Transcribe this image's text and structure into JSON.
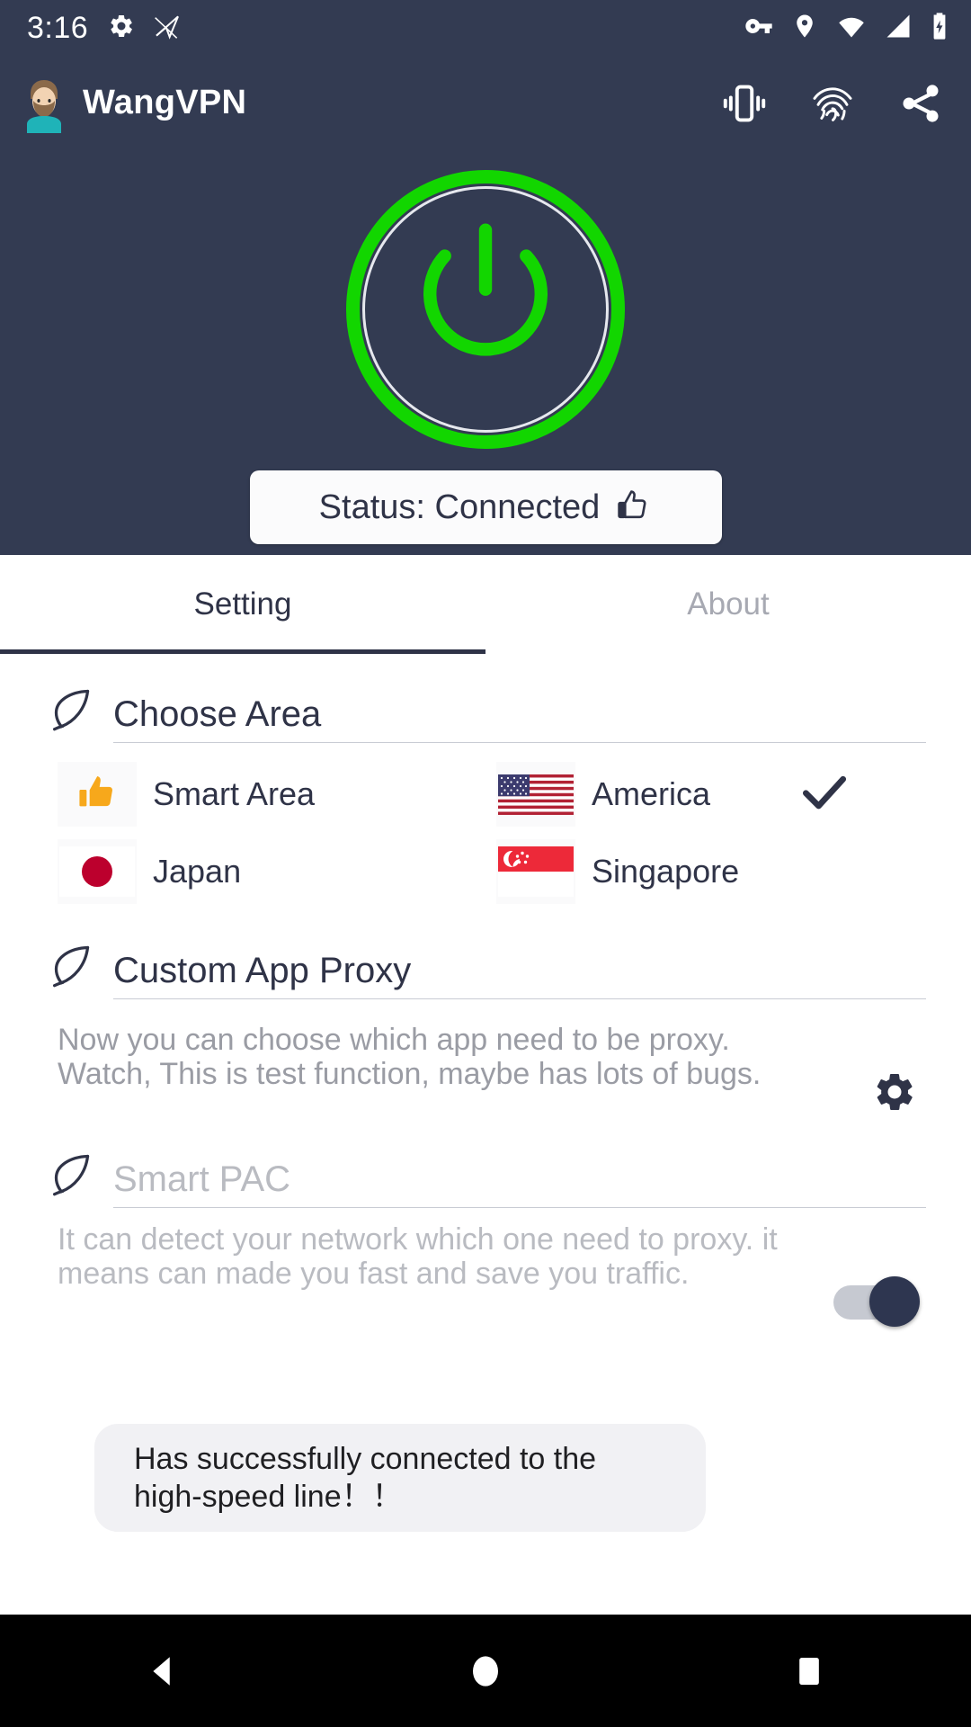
{
  "status_bar": {
    "clock": "3:16",
    "left_icons": [
      "gear-icon",
      "paper-plane-slash-icon"
    ],
    "right_icons": [
      "vpn-key-icon",
      "location-pin-icon",
      "wifi-icon",
      "cell-signal-icon",
      "battery-charging-icon"
    ]
  },
  "app_bar": {
    "title": "WangVPN",
    "avatar": "user-avatar",
    "actions": [
      "vibrate-icon",
      "fingerprint-icon",
      "share-icon"
    ]
  },
  "hero": {
    "power_button": "power-toggle-button",
    "power_state": "on",
    "status_text": "Status: Connected",
    "status_icon": "thumbs-up-icon",
    "ring_color": "#12d600",
    "background_color": "#333b52"
  },
  "tabs": [
    {
      "label": "Setting",
      "active": true
    },
    {
      "label": "About",
      "active": false
    }
  ],
  "sections": {
    "choose_area": {
      "icon": "leaf-icon",
      "title": "Choose Area",
      "options": [
        {
          "label": "Smart Area",
          "flag": "thumbs-up-orange",
          "selected": false
        },
        {
          "label": "America",
          "flag": "flag-us",
          "selected": true
        },
        {
          "label": "Japan",
          "flag": "flag-jp",
          "selected": false
        },
        {
          "label": "Singapore",
          "flag": "flag-sg",
          "selected": false
        }
      ]
    },
    "custom_app_proxy": {
      "icon": "leaf-icon",
      "title": "Custom App Proxy",
      "description": "Now you can choose which app need to be proxy.\nWatch, This is test function, maybe has lots of bugs.",
      "settings_icon": "gear-icon"
    },
    "smart_pac": {
      "icon": "leaf-icon",
      "title": "Smart PAC",
      "description": "It can detect your network which one need to proxy. it means can made you fast and save you traffic.",
      "toggle_state": "on"
    }
  },
  "toast": {
    "message": "Has successfully connected to the\nhigh-speed line！！"
  },
  "nav_bar": {
    "buttons": [
      "back-icon",
      "home-icon",
      "recents-icon"
    ]
  }
}
